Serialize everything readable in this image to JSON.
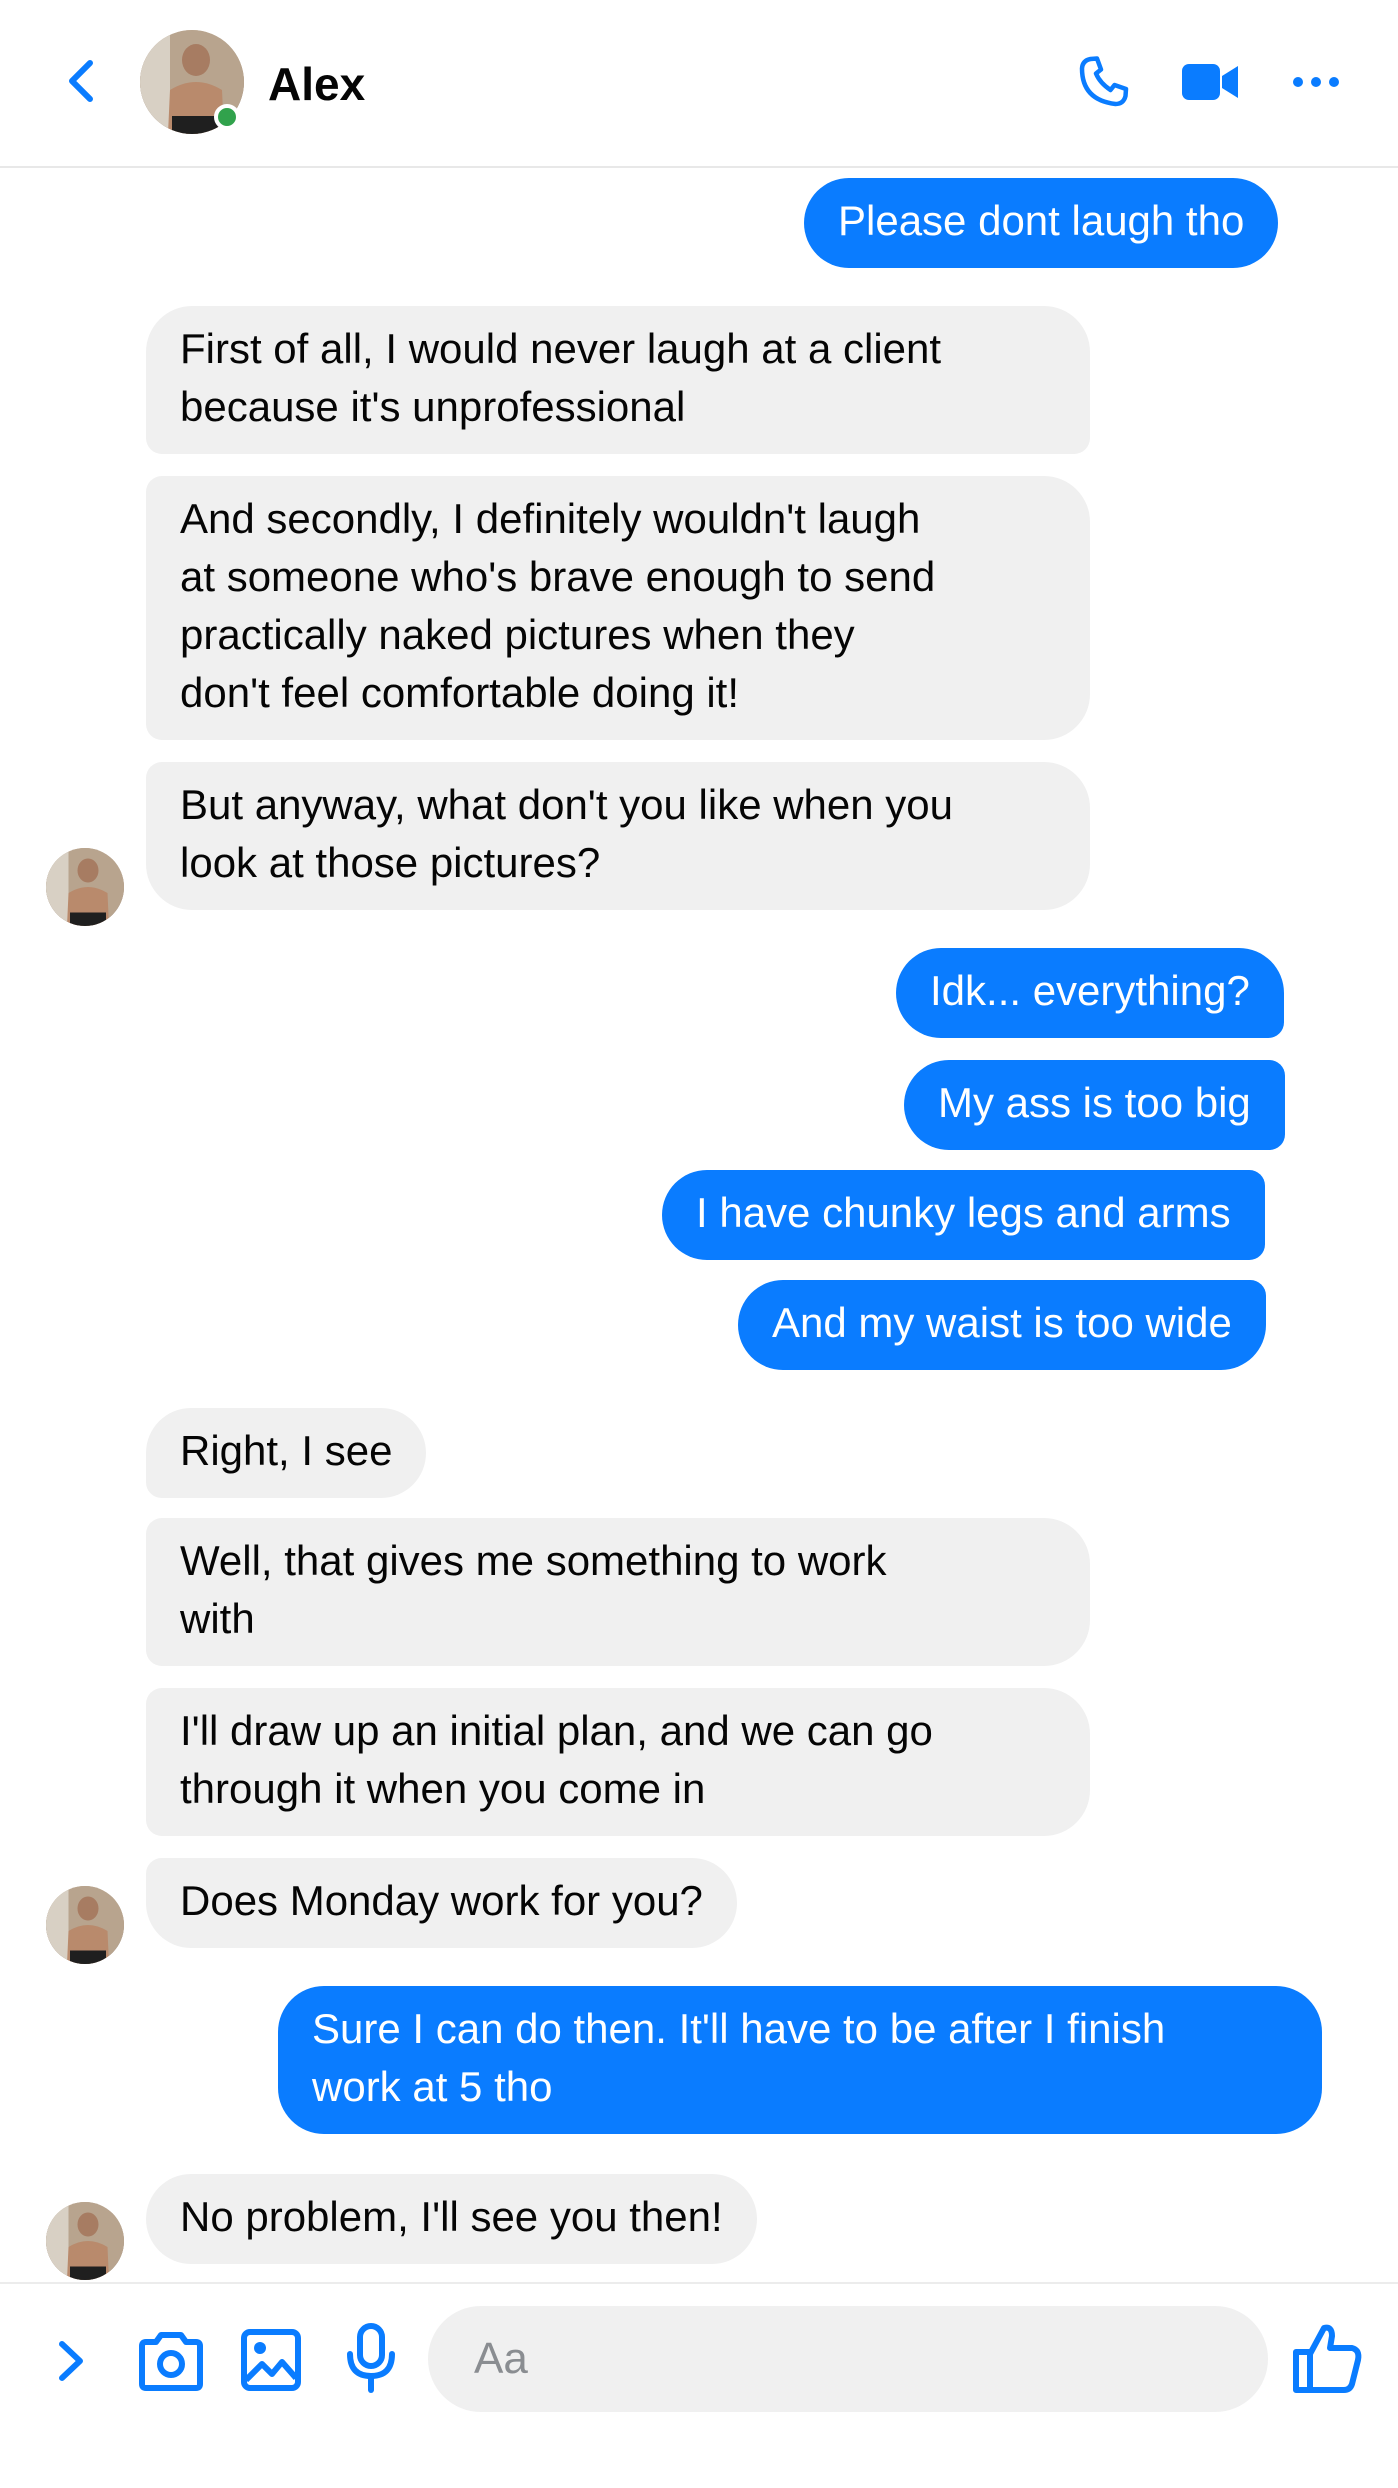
{
  "contact": {
    "name": "Alex",
    "status": "online"
  },
  "header": {
    "icons": [
      "back-chevron-icon",
      "phone-icon",
      "video-camera-icon",
      "more-dots-icon"
    ]
  },
  "messages": [
    {
      "sender": "me",
      "text": "Please dont laugh tho"
    },
    {
      "sender": "Alex",
      "text": "First of all, I would never laugh at a client\nbecause it's unprofessional"
    },
    {
      "sender": "Alex",
      "text": "And secondly, I definitely wouldn't laugh\nat someone who's brave enough to send\npractically naked pictures when they\ndon't feel comfortable doing it!"
    },
    {
      "sender": "Alex",
      "text": "But anyway, what don't you like when you\nlook at those pictures?"
    },
    {
      "sender": "me",
      "text": "Idk... everything?"
    },
    {
      "sender": "me",
      "text": "My ass is too big"
    },
    {
      "sender": "me",
      "text": "I have chunky legs and arms"
    },
    {
      "sender": "me",
      "text": "And my waist is too wide"
    },
    {
      "sender": "Alex",
      "text": "Right, I see"
    },
    {
      "sender": "Alex",
      "text": "Well, that gives me something to work\nwith"
    },
    {
      "sender": "Alex",
      "text": "I'll draw up an initial plan, and we can go\nthrough it when you come in"
    },
    {
      "sender": "Alex",
      "text": "Does Monday work for you?"
    },
    {
      "sender": "me",
      "text": "Sure I can do then. It'll have to be after I finish\nwork at 5 tho"
    },
    {
      "sender": "Alex",
      "text": "No problem, I'll see you then!"
    }
  ],
  "composer": {
    "placeholder": "Aa",
    "value": "",
    "icons": [
      "expand-chevron-icon",
      "camera-icon",
      "gallery-icon",
      "microphone-icon",
      "thumbs-up-icon"
    ]
  },
  "colors": {
    "accent": "#0a7cff",
    "incoming_bubble": "#f0f0f0",
    "online": "#31a24c",
    "placeholder": "#8a8d91"
  }
}
